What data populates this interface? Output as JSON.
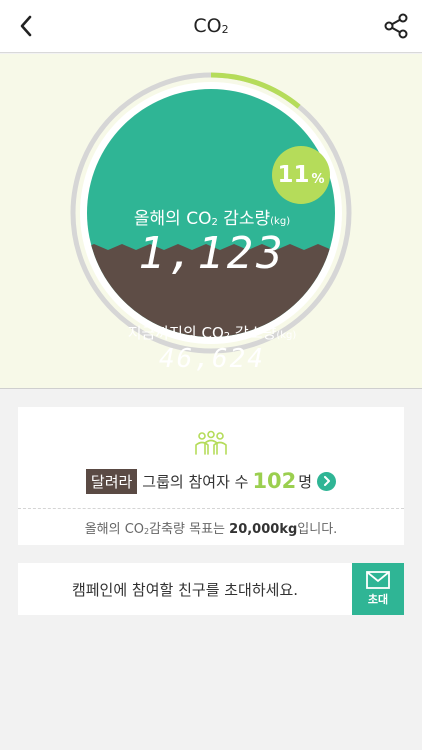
{
  "header": {
    "title_main": "CO",
    "title_sub": "2",
    "back_icon": "chevron-left-icon",
    "share_icon": "share-icon"
  },
  "hero": {
    "progress_percent": 11,
    "progress_unit": "%",
    "year_label_pre": "올해의 CO",
    "year_label_sub": "2",
    "year_label_post": " 감소량",
    "year_label_unit": "(kg)",
    "year_value": "1,123",
    "total_label_pre": "지금까지의 CO",
    "total_label_sub": "2",
    "total_label_post": " 감소량",
    "total_label_unit": "(kg)",
    "total_value": "46,624",
    "colors": {
      "teal": "#2fb595",
      "brown": "#5e4d46",
      "lime": "#b5dc5a",
      "ring": "#d6d6d6"
    }
  },
  "group": {
    "icon": "people-group-icon",
    "name": "달려라",
    "text_pre": " 그룹의 참여자 수 ",
    "count": "102",
    "count_unit": "명",
    "goal_pre": "올해의 CO",
    "goal_sub": "2",
    "goal_mid": "감축량 목표는 ",
    "goal_value": "20,000kg",
    "goal_post": "입니다."
  },
  "invite": {
    "text": "캠페인에 참여할 친구를 초대하세요.",
    "button_label": "초대",
    "button_icon": "envelope-icon"
  }
}
